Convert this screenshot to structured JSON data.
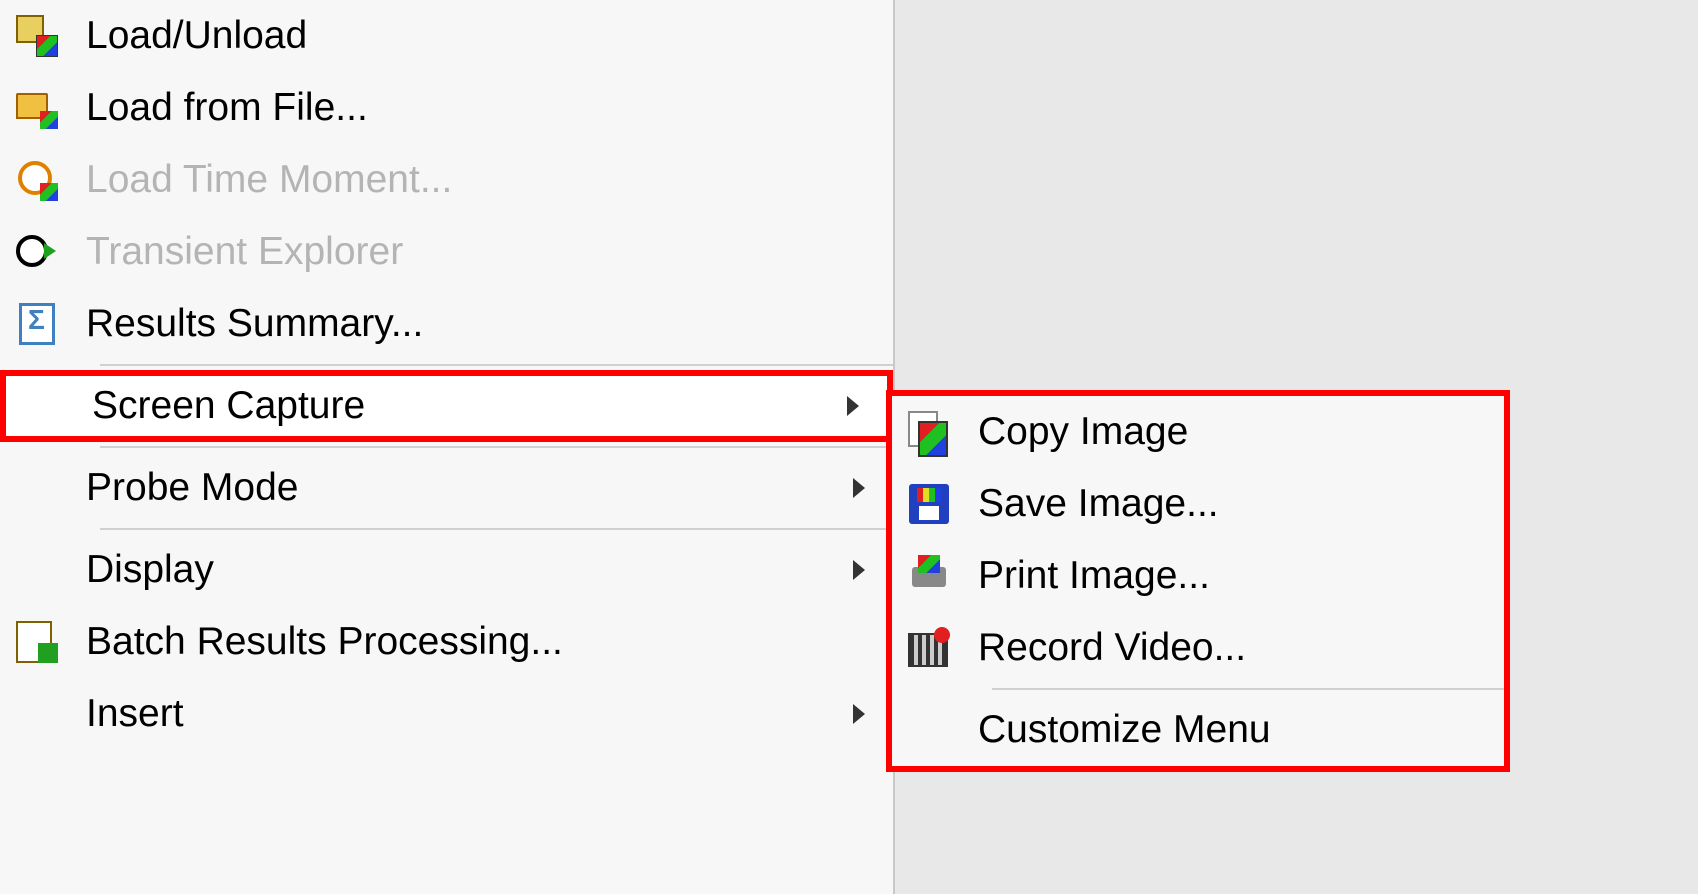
{
  "menu": {
    "items": [
      {
        "label": "Load/Unload"
      },
      {
        "label": "Load from File..."
      },
      {
        "label": "Load Time Moment..."
      },
      {
        "label": "Transient Explorer"
      },
      {
        "label": "Results Summary..."
      },
      {
        "label": "Screen Capture"
      },
      {
        "label": "Probe Mode"
      },
      {
        "label": "Display"
      },
      {
        "label": "Batch Results Processing..."
      },
      {
        "label": "Insert"
      }
    ]
  },
  "submenu": {
    "items": [
      {
        "label": "Copy Image"
      },
      {
        "label": "Save Image..."
      },
      {
        "label": "Print Image..."
      },
      {
        "label": "Record Video..."
      },
      {
        "label": "Customize Menu"
      }
    ]
  }
}
